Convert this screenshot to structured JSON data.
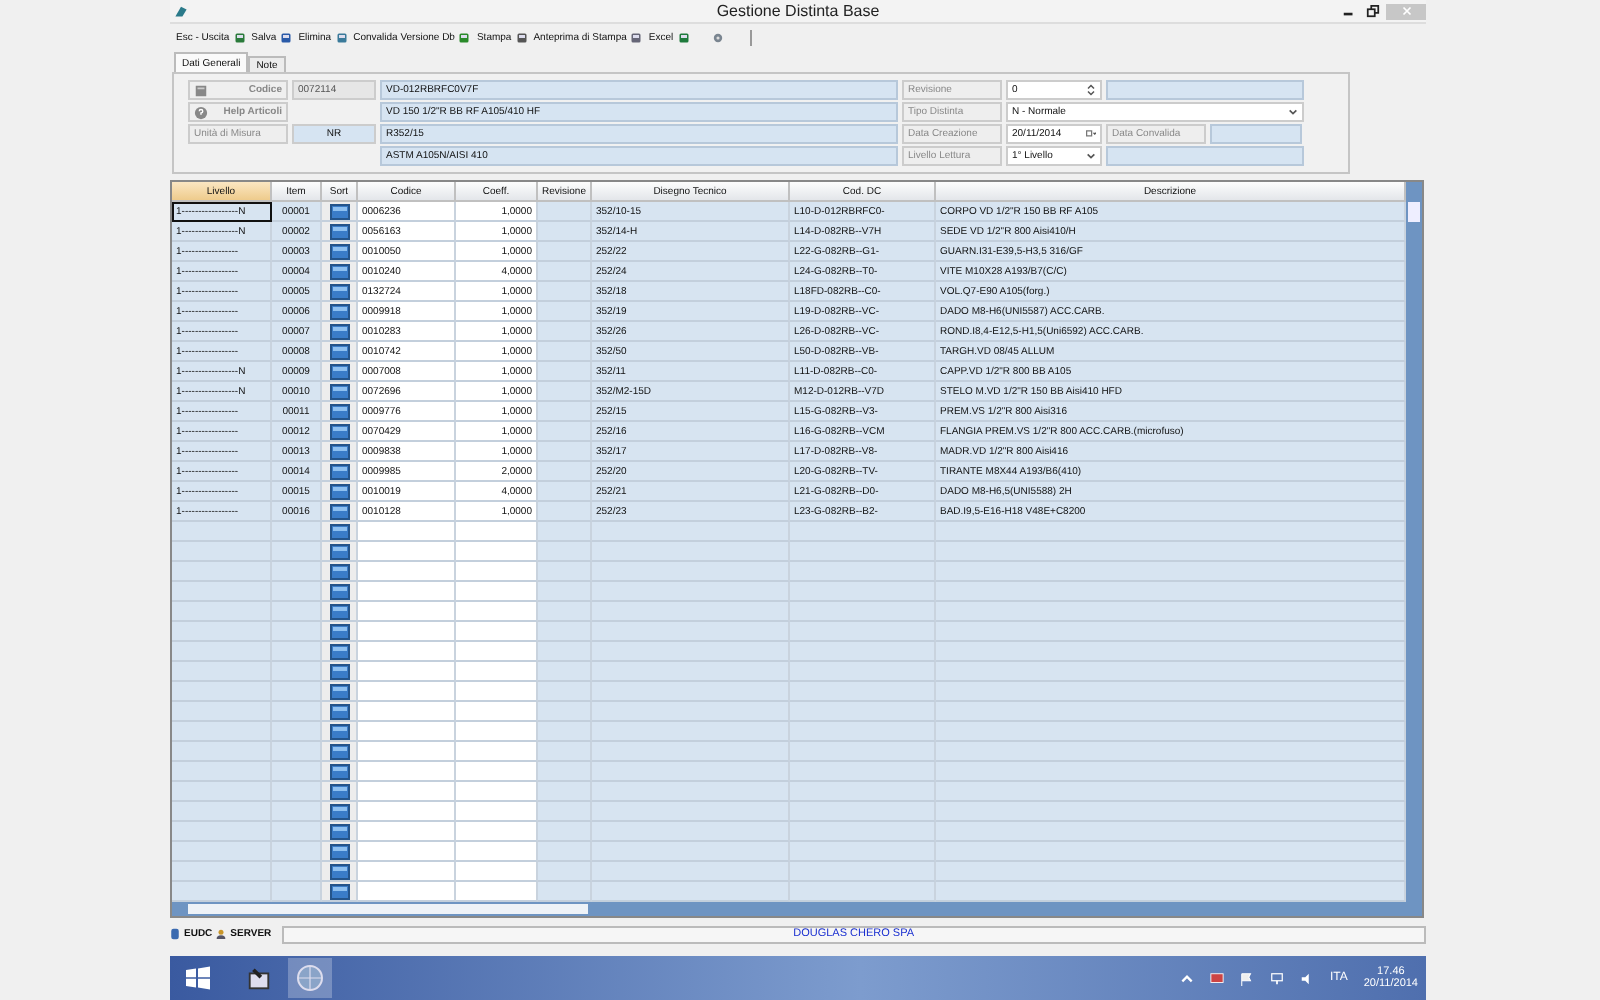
{
  "window": {
    "title": "Gestione Distinta Base"
  },
  "toolbar": [
    {
      "label": "Esc - Uscita",
      "kind": "exit"
    },
    {
      "label": "Salva",
      "kind": "save"
    },
    {
      "label": "Elimina",
      "kind": "delete"
    },
    {
      "label": "Convalida Versione Db",
      "kind": "validate"
    },
    {
      "label": "Stampa",
      "kind": "print"
    },
    {
      "label": "Anteprima di Stampa",
      "kind": "preview"
    },
    {
      "label": "Excel",
      "kind": "excel"
    }
  ],
  "tabs": [
    {
      "label": "Dati Generali",
      "selected": true
    },
    {
      "label": "Note",
      "selected": false
    }
  ],
  "header": {
    "codice": {
      "label": "Codice",
      "value": "0072114"
    },
    "help": {
      "label": "Help Articoli"
    },
    "unita": {
      "label": "Unità di Misura",
      "value": "NR"
    },
    "descrizione": [
      "VD-012RBRFC0V7F",
      "VD 150 1/2\"R BB RF A105/410 HF",
      "R352/15",
      "ASTM A105N/AISI 410"
    ],
    "revisione": {
      "label": "Revisione",
      "value": "0"
    },
    "tipo_distinta": {
      "label": "Tipo Distinta",
      "value": "N - Normale"
    },
    "data_creazione": {
      "label": "Data Creazione",
      "value": "20/11/2014"
    },
    "data_convalida": {
      "label": "Data Convalida"
    },
    "livello_lettura": {
      "label": "Livello Lettura",
      "value": "1° Livello"
    }
  },
  "table": {
    "columns": [
      "Livello",
      "Item",
      "Sort",
      "Codice",
      "Coeff.",
      "Revisione",
      "Disegno Tecnico",
      "Cod. DC",
      "Descrizione"
    ],
    "rows": [
      {
        "livello": "1-----------------N",
        "item": "00001",
        "codice": "0006236",
        "coeff": "1,0000",
        "disegno": "352/10-15",
        "cod_dc": "L10-D-012RBRFC0-",
        "descrizione": "CORPO VD 1/2\"R 150 BB RF A105",
        "selected": true
      },
      {
        "livello": "1-----------------N",
        "item": "00002",
        "codice": "0056163",
        "coeff": "1,0000",
        "disegno": "352/14-H",
        "cod_dc": "L14-D-082RB--V7H",
        "descrizione": "SEDE VD 1/2\"R 800 Aisi410/H",
        "selected": false
      },
      {
        "livello": "1-----------------",
        "item": "00003",
        "codice": "0010050",
        "coeff": "1,0000",
        "disegno": "252/22",
        "cod_dc": "L22-G-082RB--G1-",
        "descrizione": "GUARN.I31-E39,5-H3,5 316/GF",
        "selected": false
      },
      {
        "livello": "1-----------------",
        "item": "00004",
        "codice": "0010240",
        "coeff": "4,0000",
        "disegno": "252/24",
        "cod_dc": "L24-G-082RB--T0-",
        "descrizione": "VITE M10X28 A193/B7(C/C)",
        "selected": false
      },
      {
        "livello": "1-----------------",
        "item": "00005",
        "codice": "0132724",
        "coeff": "1,0000",
        "disegno": "352/18",
        "cod_dc": "L18FD-082RB--C0-",
        "descrizione": "VOL.Q7-E90 A105(forg.)",
        "selected": false
      },
      {
        "livello": "1-----------------",
        "item": "00006",
        "codice": "0009918",
        "coeff": "1,0000",
        "disegno": "352/19",
        "cod_dc": "L19-D-082RB--VC-",
        "descrizione": "DADO M8-H6(UNI5587) ACC.CARB.",
        "selected": false
      },
      {
        "livello": "1-----------------",
        "item": "00007",
        "codice": "0010283",
        "coeff": "1,0000",
        "disegno": "352/26",
        "cod_dc": "L26-D-082RB--VC-",
        "descrizione": "ROND.I8,4-E12,5-H1,5(Uni6592) ACC.CARB.",
        "selected": false
      },
      {
        "livello": "1-----------------",
        "item": "00008",
        "codice": "0010742",
        "coeff": "1,0000",
        "disegno": "352/50",
        "cod_dc": "L50-D-082RB--VB-",
        "descrizione": "TARGH.VD 08/45 ALLUM",
        "selected": false
      },
      {
        "livello": "1-----------------N",
        "item": "00009",
        "codice": "0007008",
        "coeff": "1,0000",
        "disegno": "352/11",
        "cod_dc": "L11-D-082RB--C0-",
        "descrizione": "CAPP.VD 1/2\"R 800 BB A105",
        "selected": false
      },
      {
        "livello": "1-----------------N",
        "item": "00010",
        "codice": "0072696",
        "coeff": "1,0000",
        "disegno": "352/M2-15D",
        "cod_dc": "M12-D-012RB--V7D",
        "descrizione": "STELO M.VD 1/2\"R 150 BB Aisi410 HFD",
        "selected": false
      },
      {
        "livello": "1-----------------",
        "item": "00011",
        "codice": "0009776",
        "coeff": "1,0000",
        "disegno": "252/15",
        "cod_dc": "L15-G-082RB--V3-",
        "descrizione": "PREM.VS 1/2\"R 800 Aisi316",
        "selected": false
      },
      {
        "livello": "1-----------------",
        "item": "00012",
        "codice": "0070429",
        "coeff": "1,0000",
        "disegno": "252/16",
        "cod_dc": "L16-G-082RB--VCM",
        "descrizione": "FLANGIA PREM.VS 1/2\"R 800 ACC.CARB.(microfuso)",
        "selected": false
      },
      {
        "livello": "1-----------------",
        "item": "00013",
        "codice": "0009838",
        "coeff": "1,0000",
        "disegno": "352/17",
        "cod_dc": "L17-D-082RB--V8-",
        "descrizione": "MADR.VD 1/2\"R 800 Aisi416",
        "selected": false
      },
      {
        "livello": "1-----------------",
        "item": "00014",
        "codice": "0009985",
        "coeff": "2,0000",
        "disegno": "252/20",
        "cod_dc": "L20-G-082RB--TV-",
        "descrizione": "TIRANTE M8X44 A193/B6(410)",
        "selected": false
      },
      {
        "livello": "1-----------------",
        "item": "00015",
        "codice": "0010019",
        "coeff": "4,0000",
        "disegno": "252/21",
        "cod_dc": "L21-G-082RB--D0-",
        "descrizione": "DADO M8-H6,5(UNI5588) 2H",
        "selected": false
      },
      {
        "livello": "1-----------------",
        "item": "00016",
        "codice": "0010128",
        "coeff": "1,0000",
        "disegno": "252/23",
        "cod_dc": "L23-G-082RB--B2-",
        "descrizione": "BAD.I9,5-E16-H18 V48E+C8200",
        "selected": false
      }
    ]
  },
  "status_bar": {
    "user": "EUDC",
    "server": "SERVER",
    "company": "DOUGLAS CHERO SPA"
  },
  "taskbar": {
    "language": "ITA",
    "time": "17.46",
    "date": "20/11/2014"
  }
}
